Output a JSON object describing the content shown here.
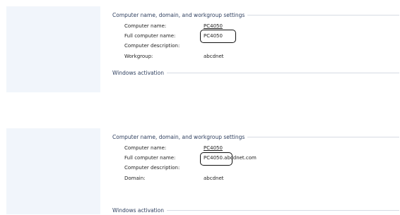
{
  "top": {
    "section_title": "Computer name, domain, and workgroup settings",
    "rows": [
      {
        "label": "Computer name:",
        "value": "PC4050"
      },
      {
        "label": "Full computer name:",
        "value": "PC4050"
      },
      {
        "label": "Computer description:",
        "value": ""
      },
      {
        "label": "Workgroup:",
        "value": "abcdnet"
      }
    ],
    "activation": "Windows activation"
  },
  "bottom": {
    "section_title": "Computer name, domain, and workgroup settings",
    "rows": [
      {
        "label": "Computer name:",
        "value": "PC4050"
      },
      {
        "label": "Full computer name:",
        "value_main": "PC4050",
        "value_suffix": ".abcdnet.com"
      },
      {
        "label": "Computer description:",
        "value": ""
      },
      {
        "label": "Domain:",
        "value": "abcdnet"
      }
    ],
    "activation": "Windows activation"
  },
  "colors": {
    "section_text": "#2d3e5e",
    "left_pane": "#f1f5fb",
    "rule": "#d6dbe3",
    "highlight": "#111111"
  }
}
